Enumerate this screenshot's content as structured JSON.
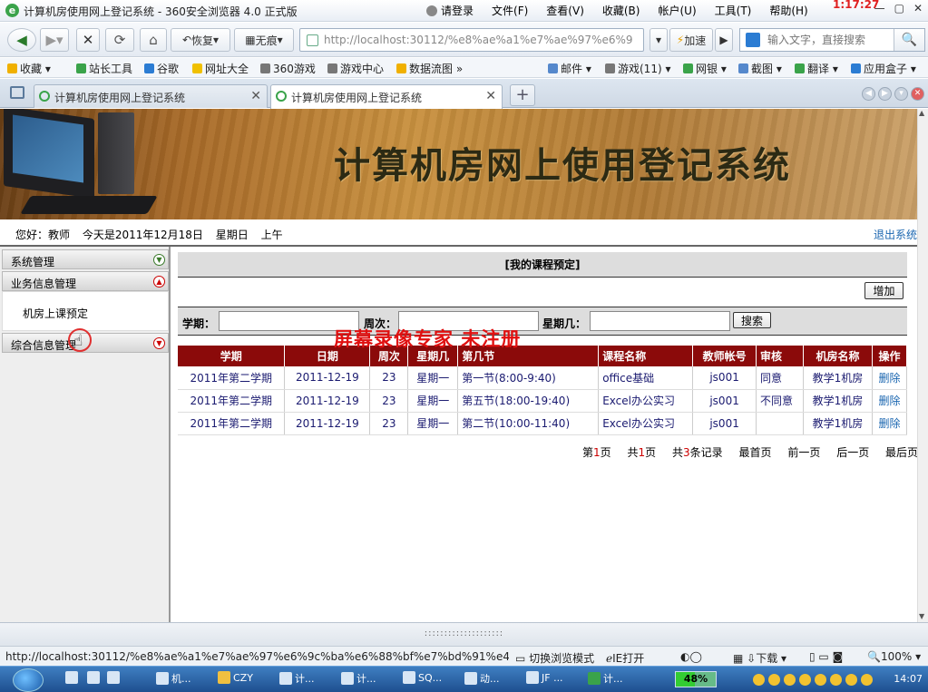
{
  "browser": {
    "title": "计算机房使用网上登记系统 - 360安全浏览器 4.0 正式版",
    "menu": [
      "请登录",
      "文件(F)",
      "查看(V)",
      "收藏(B)",
      "帐户(U)",
      "工具(T)",
      "帮助(H)"
    ],
    "overlay_clock": "1:17:27",
    "nav": {
      "restore": "恢复",
      "incognito": "无痕",
      "accelerate": "加速"
    },
    "address": "http://localhost:30112/%e8%ae%a1%e7%ae%97%e6%9",
    "search_placeholder": "输入文字，直接搜索",
    "bookmarks": [
      "收藏",
      "站长工具",
      "谷歌",
      "网址大全",
      "360游戏",
      "游戏中心",
      "数据流图",
      "邮件",
      "游戏(11)",
      "网银",
      "截图",
      "翻译",
      "应用盒子"
    ],
    "tabs": [
      {
        "label": "计算机房使用网上登记系统",
        "active": false
      },
      {
        "label": "计算机房使用网上登记系统",
        "active": true
      }
    ]
  },
  "site": {
    "banner_title": "计算机房网上使用登记系统",
    "greeting": {
      "hello": "您好：教师",
      "today": "今天是2011年12月18日",
      "weekday": "星期日",
      "period": "上午"
    },
    "logout": "退出系统"
  },
  "sidebar": {
    "sections": [
      {
        "label": "系统管理",
        "expanded": false
      },
      {
        "label": "业务信息管理",
        "expanded": true
      },
      {
        "label": "综合信息管理",
        "expanded": false
      }
    ],
    "items": [
      "机房上课预定"
    ]
  },
  "main": {
    "panel_title": "[我的课程预定]",
    "add_button": "增加",
    "filters": {
      "semester": "学期：",
      "week": "周次：",
      "weekday": "星期几：",
      "search_button": "搜索"
    },
    "watermark": "屏幕录像专家  未注册",
    "table": {
      "headers": [
        "学期",
        "日期",
        "周次",
        "星期几",
        "第几节",
        "课程名称",
        "教师帐号",
        "审核",
        "机房名称",
        "操作"
      ],
      "rows": [
        [
          "2011年第二学期",
          "2011-12-19",
          "23",
          "星期一",
          "第一节(8:00-9:40)",
          "office基础",
          "js001",
          "同意",
          "教学1机房",
          "删除"
        ],
        [
          "2011年第二学期",
          "2011-12-19",
          "23",
          "星期一",
          "第五节(18:00-19:40)",
          "Excel办公实习",
          "js001",
          "不同意",
          "教学1机房",
          "删除"
        ],
        [
          "2011年第二学期",
          "2011-12-19",
          "23",
          "星期一",
          "第二节(10:00-11:40)",
          "Excel办公实习",
          "js001",
          "",
          "教学1机房",
          "删除"
        ]
      ]
    },
    "pager": {
      "page_pre": "第",
      "page_num": "1",
      "page_suf": "页",
      "total_pre": "共",
      "total_num": "1",
      "total_suf": "页",
      "records_pre": "共",
      "records_num": "3",
      "records_suf": "条记录",
      "first": "最首页",
      "prev": "前一页",
      "next": "后一页",
      "last": "最后页"
    }
  },
  "status": {
    "url": "http://localhost:30112/%e8%ae%a1%e7%ae%97%e6%9c%ba%e6%88%bf%e7%bd%91%e4...",
    "switch_mode": "切换浏览模式",
    "ie_open": "IE打开",
    "download": "下载",
    "zoom": "100%",
    "splitter": "::::::::::::::::::::"
  },
  "taskbar": {
    "items": [
      "机...",
      "CZY",
      "计...",
      "计...",
      "SQ...",
      "动...",
      "JF ...",
      "计..."
    ],
    "battery": "48%",
    "clock": "14:07"
  }
}
